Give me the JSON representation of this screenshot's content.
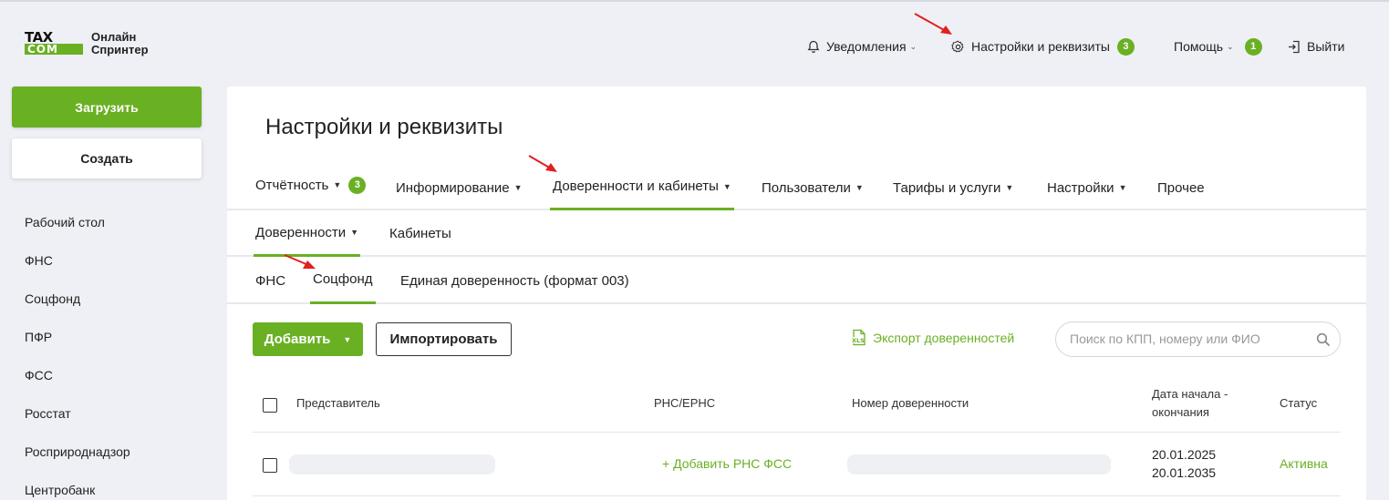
{
  "brand": {
    "logo_top": "TAX",
    "logo_bottom": "COM",
    "line1": "Онлайн",
    "line2": "Спринтер"
  },
  "topnav": {
    "notifications": "Уведомления",
    "settings": "Настройки и реквизиты",
    "settings_badge": "3",
    "help": "Помощь",
    "help_badge": "1",
    "logout": "Выйти"
  },
  "sidebar": {
    "upload": "Загрузить",
    "create": "Создать",
    "items": [
      "Рабочий стол",
      "ФНС",
      "Соцфонд",
      "ПФР",
      "ФСС",
      "Росстат",
      "Росприроднадзор",
      "Центробанк"
    ]
  },
  "page": {
    "title": "Настройки и реквизиты"
  },
  "tabs_main": [
    {
      "label": "Отчётность",
      "badge": "3"
    },
    {
      "label": "Информирование"
    },
    {
      "label": "Доверенности и кабинеты"
    },
    {
      "label": "Пользователи"
    },
    {
      "label": "Тарифы и услуги"
    },
    {
      "label": "Настройки"
    },
    {
      "label": "Прочее"
    }
  ],
  "tabs_sub": [
    "Доверенности",
    "Кабинеты"
  ],
  "tabs_third": [
    "ФНС",
    "Соцфонд",
    "Единая доверенность (формат 003)"
  ],
  "toolbar": {
    "add": "Добавить",
    "import": "Импортировать",
    "export": "Экспорт доверенностей",
    "search_placeholder": "Поиск по КПП, номеру или ФИО"
  },
  "table": {
    "headers": {
      "representative": "Представитель",
      "rns": "РНС/ЕРНС",
      "number": "Номер доверенности",
      "dates_line1": "Дата начала -",
      "dates_line2": "окончания",
      "status": "Статус"
    },
    "rows": [
      {
        "rns_action": "+ Добавить РНС ФСС",
        "start": "20.01.2025",
        "end": "20.01.2035",
        "status": "Активна"
      }
    ]
  },
  "colors": {
    "accent": "#6ab023",
    "arrow": "#e02020"
  }
}
